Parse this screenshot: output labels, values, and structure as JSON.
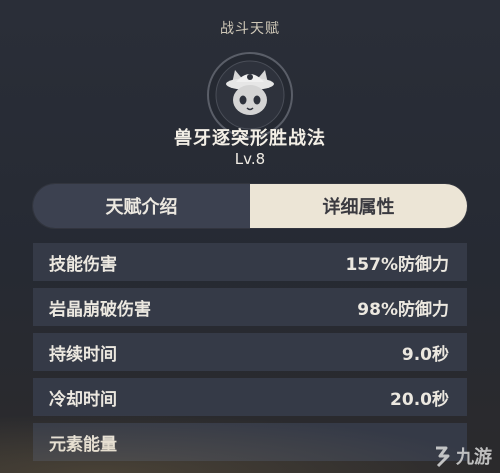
{
  "header": {
    "category": "战斗天赋"
  },
  "talent": {
    "icon": "cat-mask-icon",
    "name": "兽牙逐突形胜战法",
    "level": "Lv.8"
  },
  "tabs": [
    {
      "label": "天赋介绍",
      "active": false
    },
    {
      "label": "详细属性",
      "active": true
    }
  ],
  "attributes": [
    {
      "label": "技能伤害",
      "value": "157%防御力"
    },
    {
      "label": "岩晶崩破伤害",
      "value": "98%防御力"
    },
    {
      "label": "持续时间",
      "value": "9.0秒"
    },
    {
      "label": "冷却时间",
      "value": "20.0秒"
    },
    {
      "label": "元素能量",
      "value": ""
    }
  ],
  "watermark": {
    "text": "九游"
  },
  "colors": {
    "tab_active": "#ece5d6",
    "tab_inactive": "#3c4150",
    "row_bg": "#353a47"
  }
}
